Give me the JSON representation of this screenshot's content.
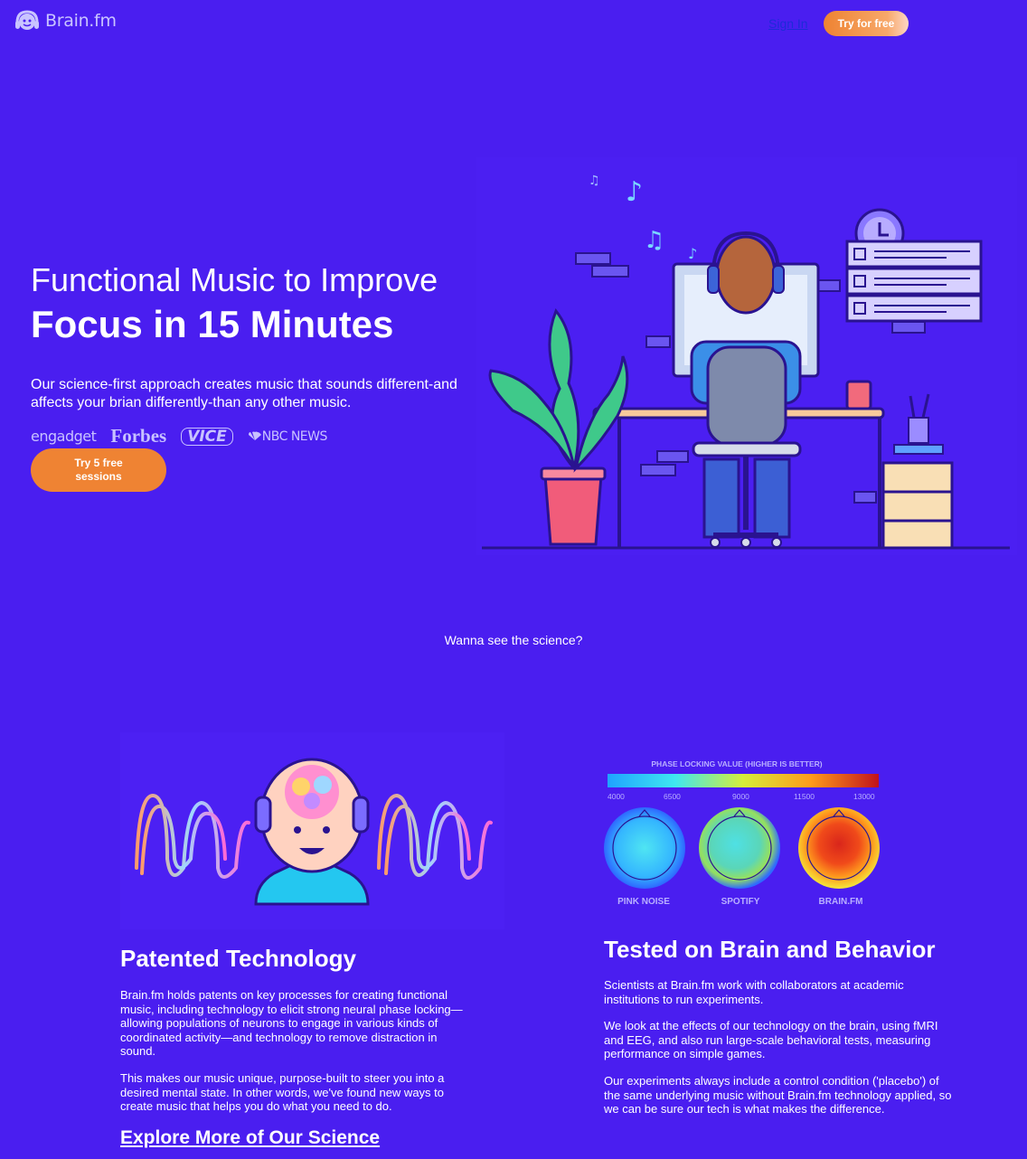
{
  "header": {
    "logo_text": "Brain.fm",
    "signin_label": "Sign In",
    "try_label": "Try for free"
  },
  "hero": {
    "title_line1": "Functional Music to Improve",
    "title_line2": "Focus in 15 Minutes",
    "description": "Our science-first approach creates music that sounds different-and affects your brian differently-than any other music.",
    "press": [
      "engadget",
      "Forbes",
      "VICE",
      "NBC NEWS"
    ],
    "cta_label": "Try 5 free sessions"
  },
  "science_link": "Wanna see the science?",
  "brain_chart": {
    "title": "PHASE LOCKING VALUE (HIGHER IS BETTER)",
    "ticks": [
      "4000",
      "6500",
      "9000",
      "11500",
      "13000"
    ],
    "labels": [
      "PINK NOISE",
      "SPOTIFY",
      "BRAIN.FM"
    ]
  },
  "patented": {
    "title": "Patented Technology",
    "p1": "Brain.fm holds patents on key processes for creating functional music, including technology to elicit strong neural phase locking—allowing populations of neurons to engage in various kinds of coordinated activity—and technology to remove distraction in sound.",
    "p2": "This makes our music unique, purpose-built to steer you into a desired mental state. In other words, we've found new ways to create music that helps you do what you need to do.",
    "link": "Explore More of Our Science"
  },
  "tested": {
    "title": "Tested on Brain and Behavior",
    "p1": "Scientists at Brain.fm work with collaborators at academic institutions to run experiments.",
    "p2": "We look at the effects of our technology on the brain, using fMRI and EEG, and also run large-scale behavioral tests, measuring performance on simple games.",
    "p3": "Our experiments always include a control condition ('placebo') of the same underlying music without Brain.fm technology applied, so we can be sure our tech is what makes the difference."
  },
  "colors": {
    "background": "#4a1ef0",
    "accent_orange": "#ef8333",
    "link_blue": "#1d2bd8"
  }
}
